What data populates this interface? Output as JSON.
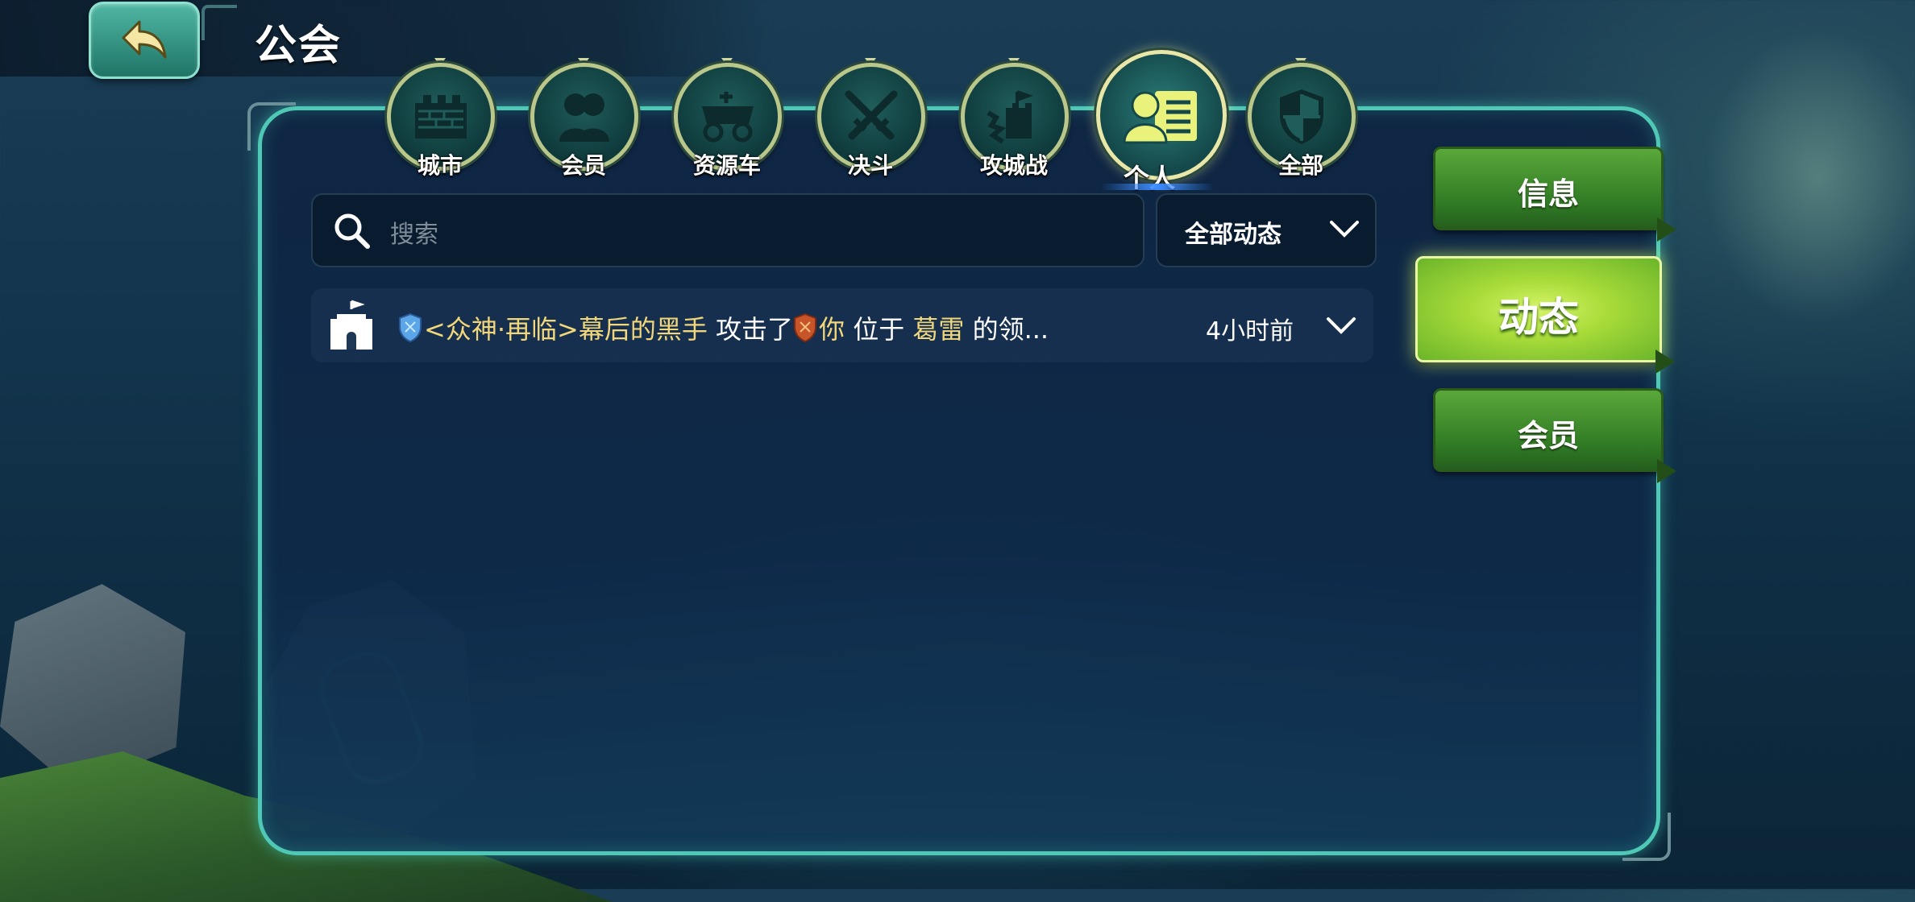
{
  "header": {
    "title": "公会"
  },
  "tabs": [
    {
      "label": "城市",
      "icon": "city-wall-icon"
    },
    {
      "label": "会员",
      "icon": "members-icon"
    },
    {
      "label": "资源车",
      "icon": "resource-cart-icon"
    },
    {
      "label": "决斗",
      "icon": "crossed-swords-icon"
    },
    {
      "label": "攻城战",
      "icon": "siege-icon"
    },
    {
      "label": "个人",
      "icon": "personal-card-icon",
      "active": true
    },
    {
      "label": "全部",
      "icon": "shield-icon"
    }
  ],
  "search": {
    "placeholder": "搜索"
  },
  "filter": {
    "value": "全部动态"
  },
  "feed": [
    {
      "guild_tag": "<众神·再临>",
      "attacker": "幕后的黑手",
      "action": "攻击了",
      "target": "你",
      "preposition": "位于",
      "location": "葛雷",
      "suffix": "的领...",
      "time": "4小时前"
    }
  ],
  "side_tabs": [
    {
      "label": "信息"
    },
    {
      "label": "动态",
      "active": true
    },
    {
      "label": "会员"
    }
  ],
  "colors": {
    "accent": "#4fc9b5",
    "gold_text": "#f2d67a",
    "active_side": "#a9dc3a",
    "tab_ring": "#b9c78a"
  }
}
